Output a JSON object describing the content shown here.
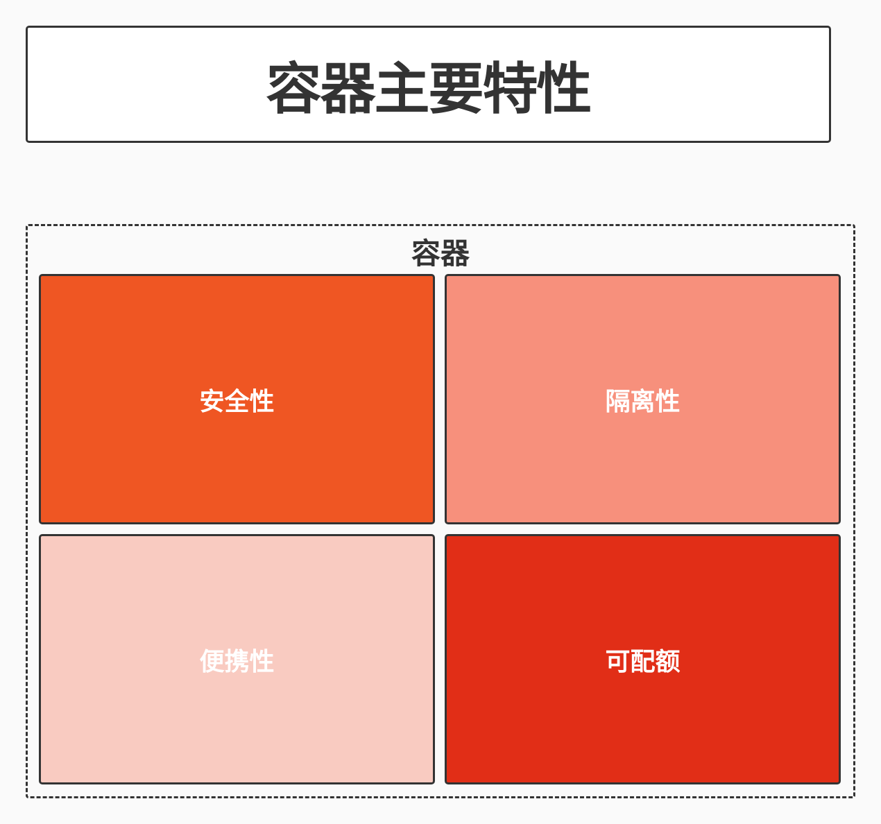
{
  "title": "容器主要特性",
  "container": {
    "label": "容器",
    "cells": [
      {
        "label": "安全性",
        "color": "#ef5623"
      },
      {
        "label": "隔离性",
        "color": "#f7907c"
      },
      {
        "label": "便携性",
        "color": "#f9cbc1"
      },
      {
        "label": "可配额",
        "color": "#e12e17"
      }
    ]
  }
}
